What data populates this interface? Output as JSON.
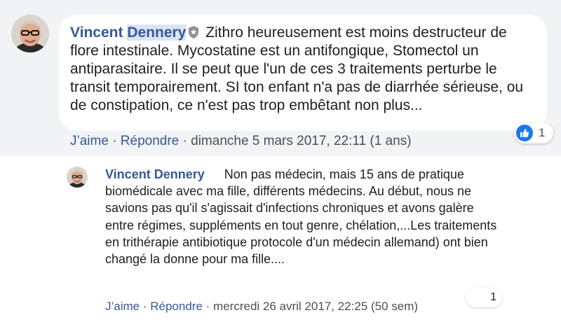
{
  "comment": {
    "author": "Vincent Dennery",
    "author_first": "Vincent",
    "author_last": "Dennery",
    "badge_icon": "shield-badge-icon",
    "text": "Zithro heureusement est moins destructeur de flore intestinale. Mycostatine est un antifongique, Stomectol un antiparasitaire. Il se peut que l'un de ces 3 traitements perturbe le transit temporairement. SI ton enfant n'a pas de diarrhée sérieuse, ou de constipation, ce n'est pas trop embêtant non plus...",
    "like_label": "J’aime",
    "reply_label": "Répondre",
    "timestamp": "dimanche 5 mars 2017, 22:11 (1 ans)",
    "reaction_icon": "like-thumb-icon",
    "reaction_count": "1"
  },
  "reply": {
    "author": "Vincent Dennery",
    "text": "Non pas médecin, mais 15 ans de pratique biomédicale avec ma fille, différents médecins. Au début, nous ne savions pas qu'il s'agissait d'infections chroniques et avons galère entre régimes, suppléments en tout genre, chélation,...Les traitements en trithérapie antibiotique protocole d'un médecin allemand) ont bien changé la donne pour ma fille....",
    "like_label": "J’aime",
    "reply_label": "Répondre",
    "timestamp": "mercredi 26 avril 2017, 22:25 (50 sem)",
    "reaction_count": "1"
  },
  "colors": {
    "author_link": "#365899",
    "action_link": "#385898",
    "like_blue": "#1877f2",
    "band_bg": "#f2f3f5"
  }
}
